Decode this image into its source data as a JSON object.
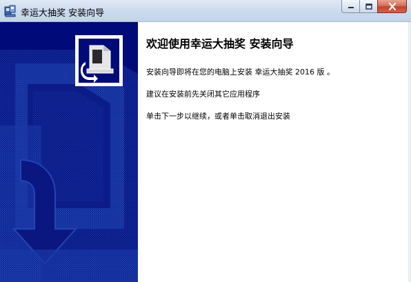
{
  "window": {
    "title": "幸运大抽奖 安装向导",
    "icon": "installer-app-icon",
    "buttons": {
      "minimize": "minimize-icon",
      "maximize": "maximize-icon",
      "close": "close-icon"
    },
    "close_color": "#c5442a"
  },
  "banner": {
    "background_color": "#000a78",
    "logo": "installer-computer-icon"
  },
  "content": {
    "heading": "欢迎使用幸运大抽奖 安装向导",
    "paragraph1": "安装向导即将在您的电脑上安装 幸运大抽奖 2016 版 。",
    "paragraph2": "建议在安装前先关闭其它应用程序",
    "paragraph3": "单击下一步以继续，或者单击取消退出安装"
  }
}
